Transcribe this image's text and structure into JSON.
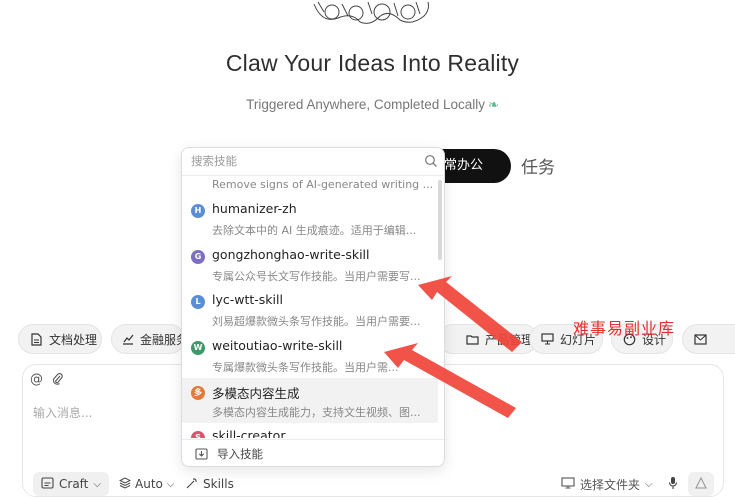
{
  "hero": {
    "title": "Claw Your Ideas Into Reality",
    "subtitle": "Triggered Anywhere, Completed Locally"
  },
  "modes": {
    "active_label": "常办公",
    "task_label": "任务"
  },
  "categories": [
    {
      "label": "文档处理",
      "icon": "document-icon"
    },
    {
      "label": "金融服务",
      "icon": "chart-icon"
    },
    {
      "label": "产品管理",
      "icon": "folder-icon"
    },
    {
      "label": "幻灯片",
      "icon": "slides-icon"
    },
    {
      "label": "设计",
      "icon": "palette-icon"
    },
    {
      "label": "",
      "icon": "mail-icon"
    }
  ],
  "skill_picker": {
    "search_placeholder": "搜索技能",
    "truncated_top_desc": "Remove signs of AI-generated writing ...",
    "items": [
      {
        "initial": "H",
        "color": "#5b8dd6",
        "name": "humanizer-zh",
        "desc": "去除文本中的 AI 生成痕迹。适用于编辑..."
      },
      {
        "initial": "G",
        "color": "#7b6fc4",
        "name": "gongzhonghao-write-skill",
        "desc": "专属公众号长文写作技能。当用户需要写..."
      },
      {
        "initial": "L",
        "color": "#5b8dd6",
        "name": "lyc-wtt-skill",
        "desc": "刘易超爆款微头条写作技能。当用户需要..."
      },
      {
        "initial": "W",
        "color": "#3e9a6a",
        "name": "weitoutiao-write-skill",
        "desc": "专属爆款微头条写作技能。当用户需..."
      },
      {
        "initial": "多",
        "color": "#e07b3c",
        "name": "多模态内容生成",
        "desc": "多模态内容生成能力，支持文生视频、图..."
      },
      {
        "initial": "S",
        "color": "#d9556c",
        "name": "skill-creator",
        "desc": ""
      }
    ],
    "import_label": "导入技能"
  },
  "composer": {
    "placeholder": "输入消息...",
    "mode_label": "Craft",
    "auto_label": "Auto",
    "skills_label": "Skills",
    "folder_label": "选择文件夹"
  },
  "watermark": "难事易副业库",
  "colors": {
    "accent_arrow": "#f0453a",
    "pill_bg": "#111111",
    "leaf": "#58b98d"
  }
}
